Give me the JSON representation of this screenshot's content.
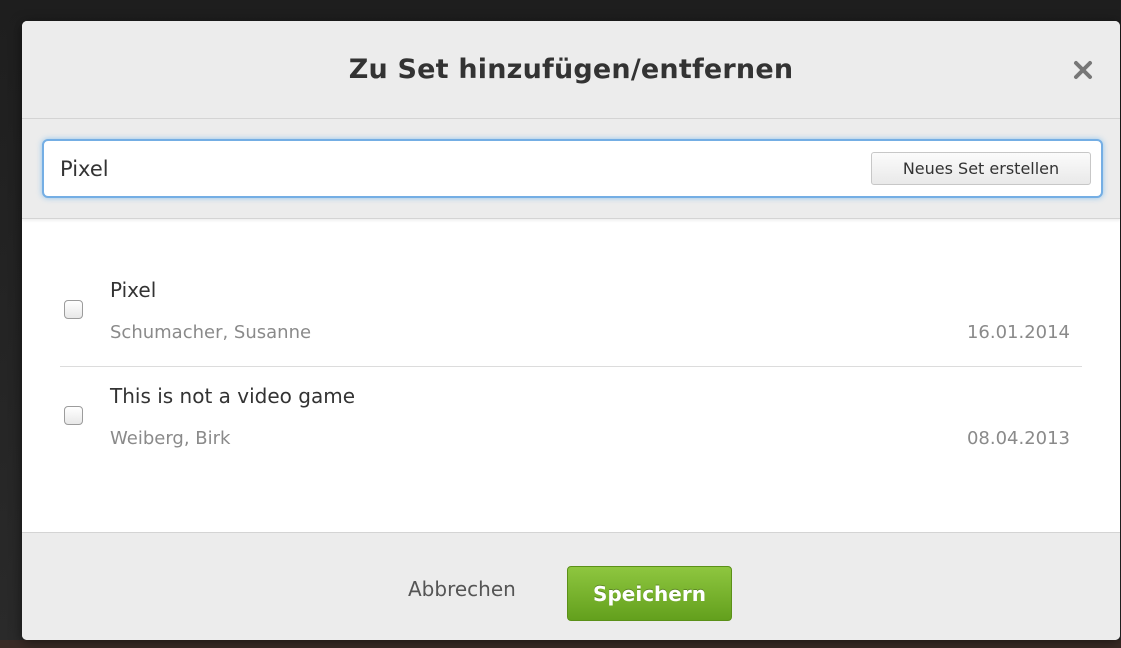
{
  "modal": {
    "title": "Zu Set hinzufügen/entfernen",
    "close_icon": "close-icon"
  },
  "search": {
    "value": "Pixel",
    "new_set_label": "Neues Set erstellen"
  },
  "sets": [
    {
      "name": "Pixel",
      "owner": "Schumacher, Susanne",
      "date": "16.01.2014",
      "checked": false
    },
    {
      "name": "This is not a video game",
      "owner": "Weiberg, Birk",
      "date": "08.04.2013",
      "checked": false
    }
  ],
  "footer": {
    "cancel_label": "Abbrechen",
    "save_label": "Speichern"
  },
  "colors": {
    "accent_focus": "#74aee4",
    "save_button": "#7ab52e",
    "header_bg": "#ececec"
  }
}
